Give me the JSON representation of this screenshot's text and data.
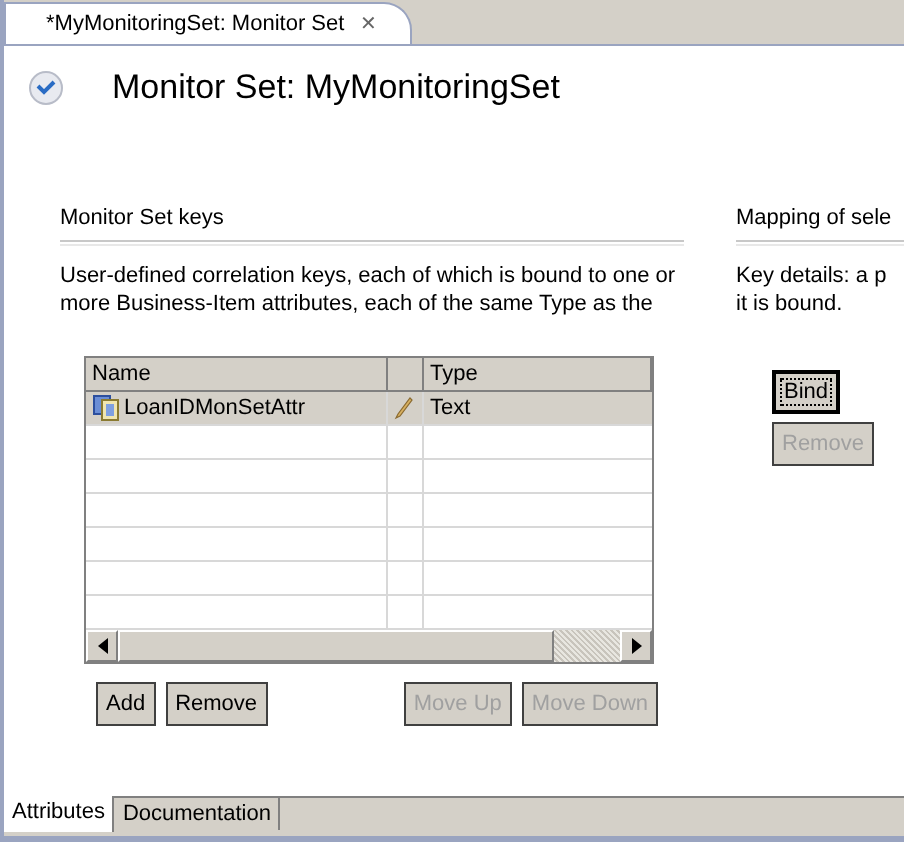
{
  "editor_tab": {
    "title": "*MyMonitoringSet: Monitor Set",
    "close": "✕"
  },
  "header": {
    "title": "Monitor Set: MyMonitoringSet"
  },
  "keys_section": {
    "title": "Monitor Set keys",
    "description": "User-defined correlation keys, each of which is bound to one or more Business-Item attributes, each of the same Type as the",
    "table": {
      "columns": [
        "Name",
        "",
        "Type"
      ],
      "rows": [
        {
          "name": "LoanIDMonSetAttr",
          "type": "Text",
          "selected": true
        }
      ]
    },
    "edit_buttons": [
      {
        "label": "Add",
        "disabled": false
      },
      {
        "label": "Remove",
        "disabled": false
      }
    ],
    "move_buttons": [
      {
        "label": "Move Up",
        "disabled": true
      },
      {
        "label": "Move Down",
        "disabled": true
      }
    ]
  },
  "mapping_section": {
    "title": "Mapping of sele",
    "description_lines": [
      "Key details: a p",
      "it is bound."
    ],
    "buttons": [
      {
        "label": "Bind",
        "disabled": false,
        "focused": true
      },
      {
        "label": "Remove",
        "disabled": true,
        "focused": false
      }
    ]
  },
  "bottom_tabs": [
    {
      "label": "Attributes",
      "selected": true
    },
    {
      "label": "Documentation",
      "selected": false
    }
  ]
}
